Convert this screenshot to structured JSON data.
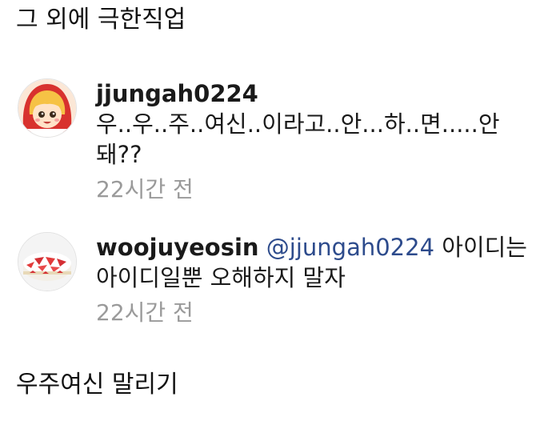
{
  "captions": {
    "top": "그 외에 극한직업",
    "bottom": "우주여신 말리기"
  },
  "comments": [
    {
      "username": "jjungah0224",
      "text": "우..우..주..여신..이라고..안...하..면.....안돼??",
      "time": "22시간 전",
      "avatar": "red-hood-girl-avatar"
    },
    {
      "username": "woojuyeosin",
      "mention": "@jjungah0224",
      "text": "아이디는 아이디일뿐 오해하지 말자",
      "time": "22시간 전",
      "avatar": "strawberry-cake-avatar"
    }
  ]
}
